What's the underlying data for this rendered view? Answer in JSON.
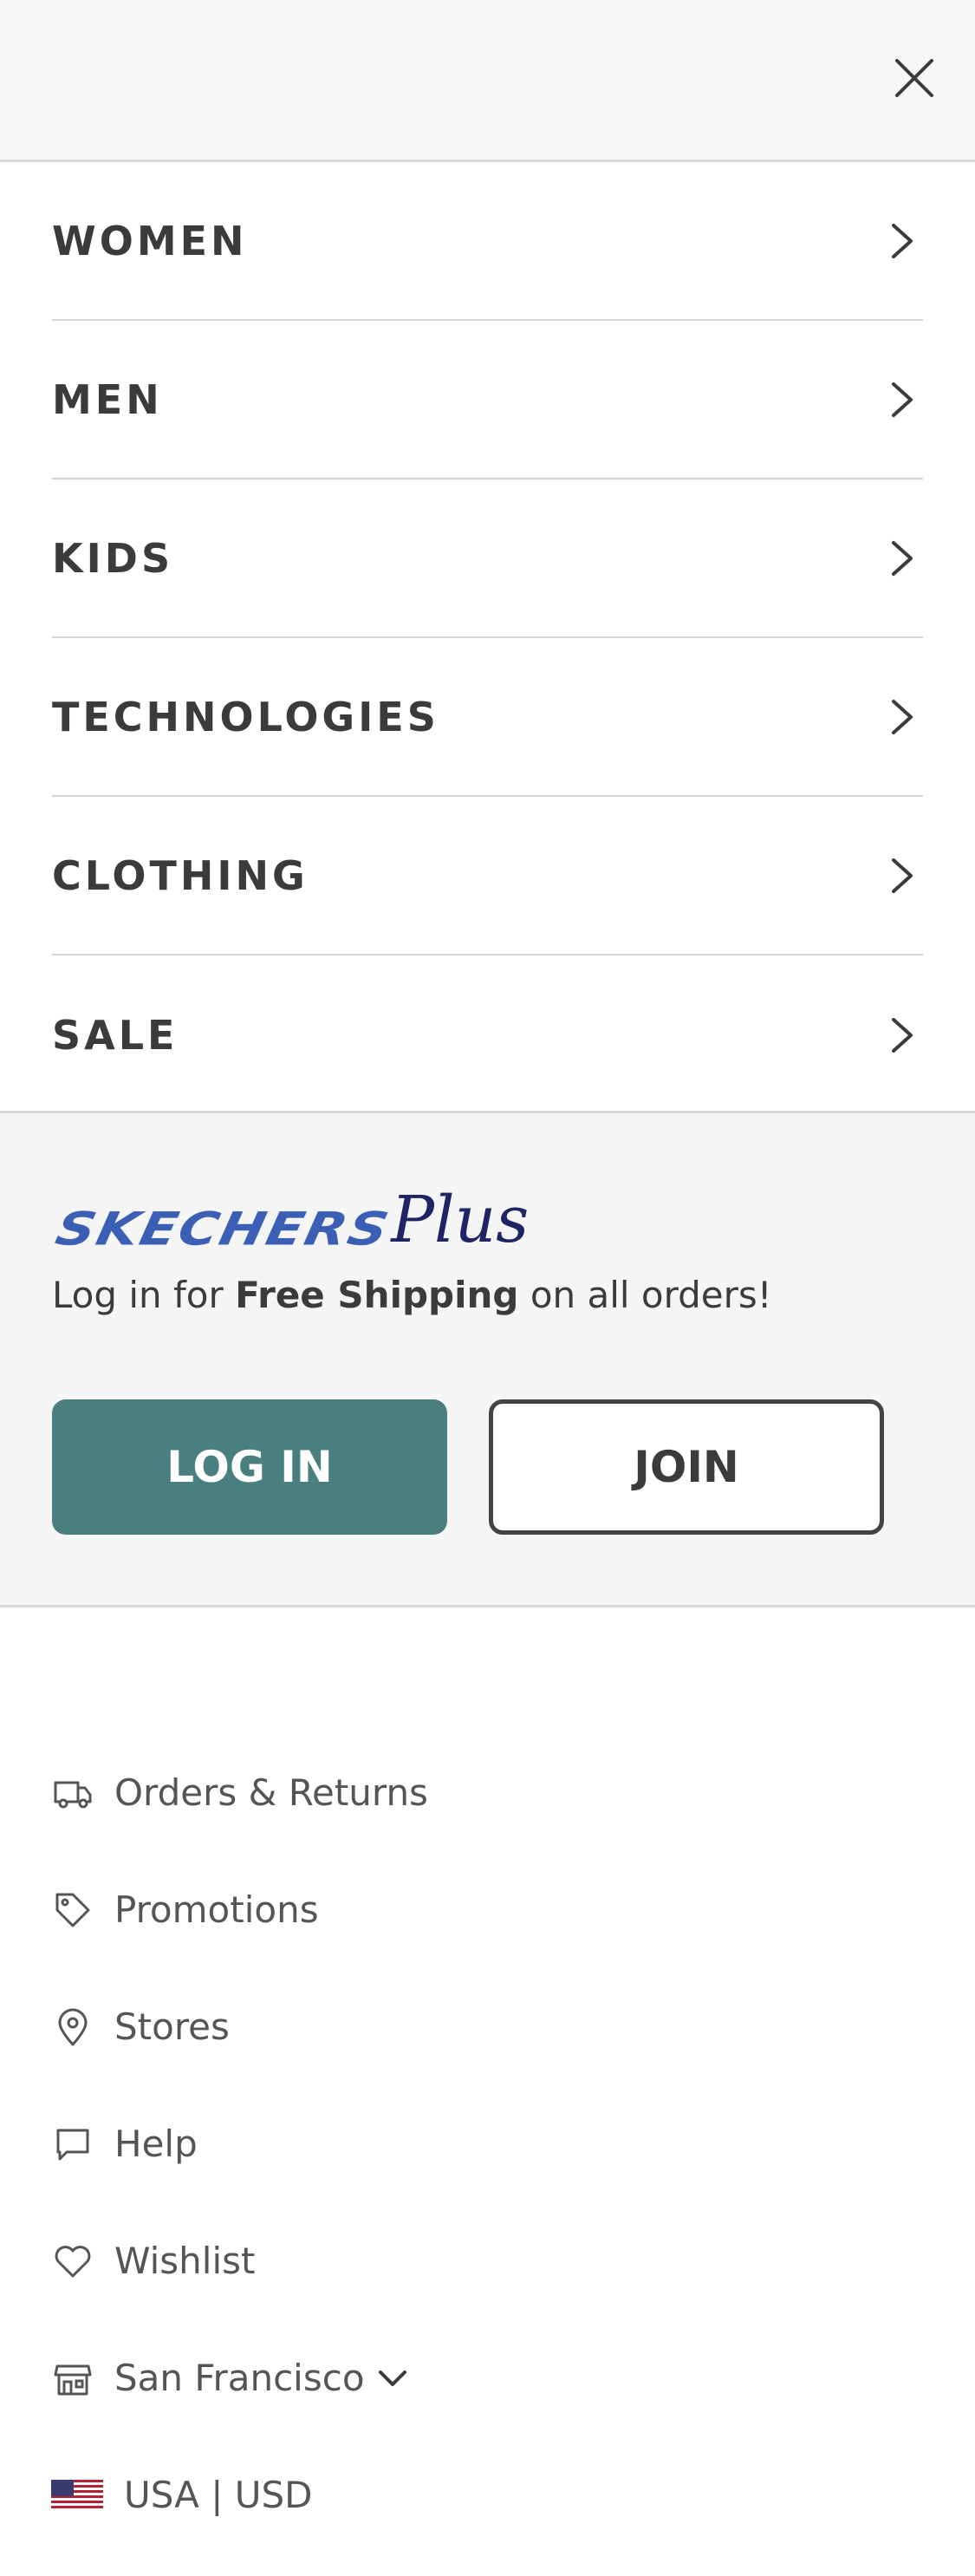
{
  "menu": {
    "items": [
      {
        "label": "WOMEN"
      },
      {
        "label": "MEN"
      },
      {
        "label": "KIDS"
      },
      {
        "label": "TECHNOLOGIES"
      },
      {
        "label": "CLOTHING"
      },
      {
        "label": "SALE"
      }
    ]
  },
  "plus": {
    "logo_brand": "SKECHERS",
    "logo_plus": "Plus",
    "promo_prefix": "Log in for ",
    "promo_bold": "Free Shipping",
    "promo_suffix": " on all orders!",
    "login_label": "LOG IN",
    "join_label": "JOIN"
  },
  "links": {
    "orders": "Orders & Returns",
    "promotions": "Promotions",
    "stores": "Stores",
    "help": "Help",
    "wishlist": "Wishlist",
    "store_location": "San Francisco",
    "locale": "USA | USD"
  },
  "colors": {
    "accent": "#4a7f80",
    "brand_blue": "#3b5fb4",
    "brand_navy": "#1f2464"
  }
}
